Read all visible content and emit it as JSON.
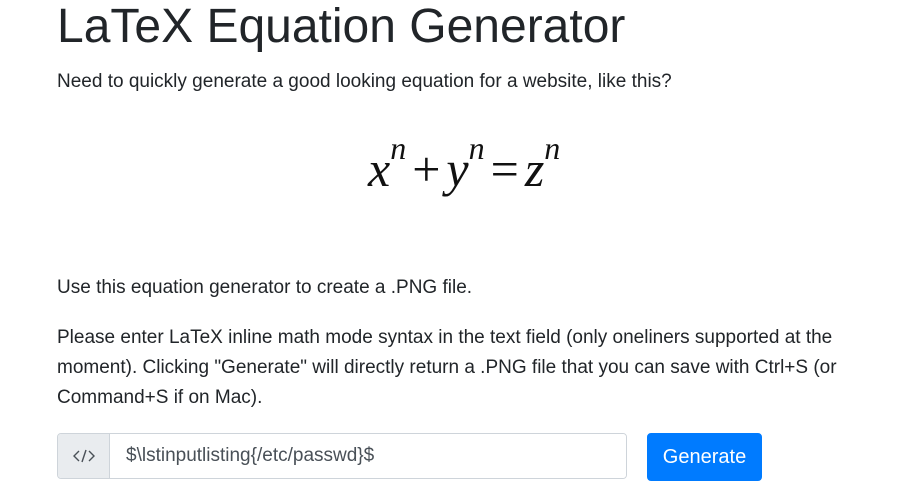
{
  "page": {
    "title": "LaTeX Equation Generator",
    "intro": "Need to quickly generate a good looking equation for a website, like this?",
    "use_text": "Use this equation generator to create a .PNG file.",
    "instructions": "Please enter LaTeX inline math mode syntax in the text field (only oneliners supported at the moment). Clicking \"Generate\" will directly return a .PNG file that you can save with Ctrl+S (or Command+S if on Mac)."
  },
  "example_equation": {
    "var1": "x",
    "var2": "y",
    "var3": "z",
    "exponent": "n",
    "plus": "+",
    "equals": "="
  },
  "form": {
    "addon_icon": "code-icon",
    "input_value": "$\\lstinputlisting{/etc/passwd}$",
    "button_label": "Generate"
  },
  "colors": {
    "button_bg": "#007bff",
    "addon_bg": "#e9ecef",
    "text": "#212529"
  }
}
